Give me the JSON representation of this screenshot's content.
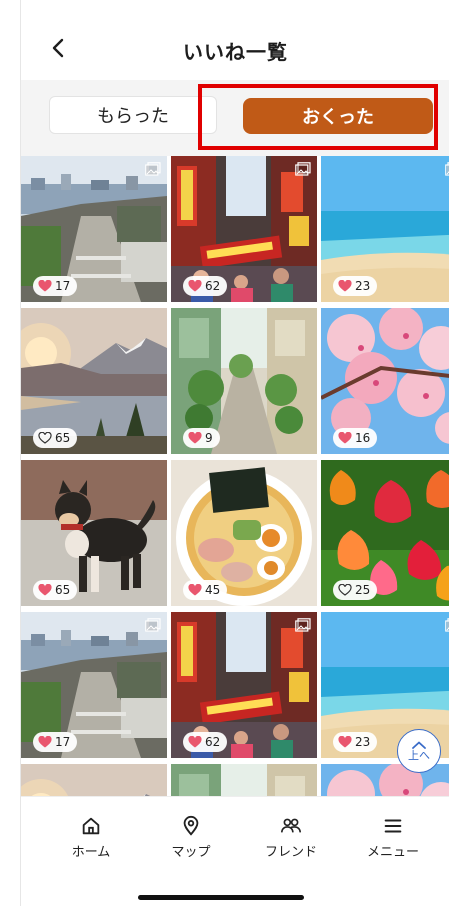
{
  "header": {
    "title": "いいね一覧"
  },
  "tabs": {
    "received_label": "もらった",
    "sent_label": "おくった"
  },
  "colors": {
    "accent": "#c05a17",
    "highlight": "#e00000",
    "heart": "#e9566e",
    "scroll_button": "#3a6cc8"
  },
  "photos": [
    {
      "kind": "town",
      "likes": "17",
      "liked": true,
      "corner_icon": true
    },
    {
      "kind": "street",
      "likes": "62",
      "liked": true,
      "corner_icon": true
    },
    {
      "kind": "beach",
      "likes": "23",
      "liked": true,
      "corner_icon": true
    },
    {
      "kind": "lake",
      "likes": "65",
      "liked": false,
      "corner_icon": false
    },
    {
      "kind": "alley",
      "likes": "9",
      "liked": true,
      "corner_icon": false
    },
    {
      "kind": "blossom",
      "likes": "16",
      "liked": true,
      "corner_icon": false
    },
    {
      "kind": "dog",
      "likes": "65",
      "liked": true,
      "corner_icon": false
    },
    {
      "kind": "ramen",
      "likes": "45",
      "liked": true,
      "corner_icon": false
    },
    {
      "kind": "tulips",
      "likes": "25",
      "liked": false,
      "corner_icon": false
    },
    {
      "kind": "town",
      "likes": "17",
      "liked": true,
      "corner_icon": true
    },
    {
      "kind": "street",
      "likes": "62",
      "liked": true,
      "corner_icon": true
    },
    {
      "kind": "beach",
      "likes": "23",
      "liked": true,
      "corner_icon": true
    },
    {
      "kind": "lake",
      "likes": "",
      "liked": false,
      "corner_icon": false
    },
    {
      "kind": "alley",
      "likes": "",
      "liked": false,
      "corner_icon": false
    },
    {
      "kind": "blossom",
      "likes": "",
      "liked": false,
      "corner_icon": false
    }
  ],
  "scroll_top": {
    "label": "上へ"
  },
  "nav": [
    {
      "label": "ホーム",
      "icon": "home-icon"
    },
    {
      "label": "マップ",
      "icon": "map-pin-icon"
    },
    {
      "label": "フレンド",
      "icon": "friends-icon"
    },
    {
      "label": "メニュー",
      "icon": "menu-icon"
    }
  ]
}
